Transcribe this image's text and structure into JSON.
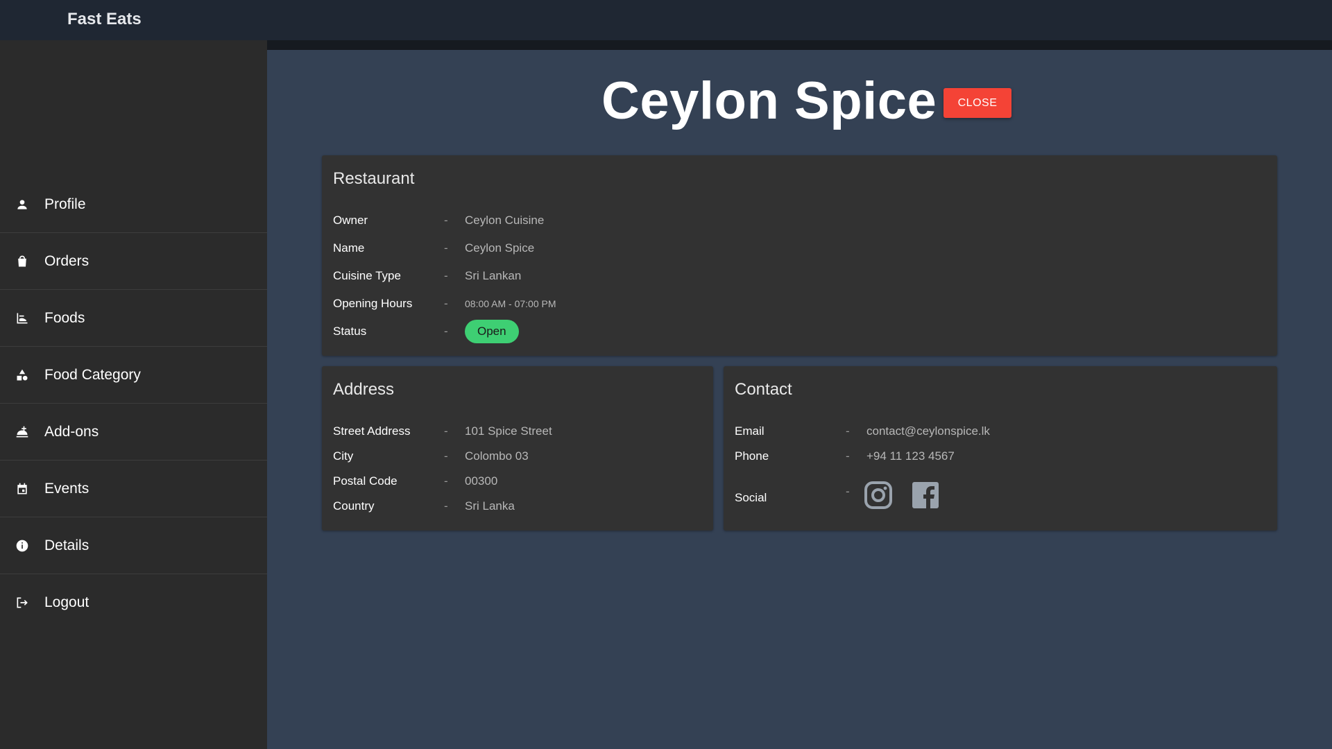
{
  "app": {
    "brand": "Fast Eats"
  },
  "sidebar": {
    "items": [
      {
        "label": "Profile",
        "icon": "person-icon"
      },
      {
        "label": "Orders",
        "icon": "shopping-bag-icon"
      },
      {
        "label": "Foods",
        "icon": "food-icon"
      },
      {
        "label": "Food Category",
        "icon": "category-icon"
      },
      {
        "label": "Add-ons",
        "icon": "addon-icon"
      },
      {
        "label": "Events",
        "icon": "calendar-icon"
      },
      {
        "label": "Details",
        "icon": "info-icon"
      },
      {
        "label": "Logout",
        "icon": "logout-icon"
      }
    ]
  },
  "header": {
    "title": "Ceylon Spice",
    "close_label": "CLOSE"
  },
  "restaurant": {
    "title": "Restaurant",
    "rows": [
      {
        "label": "Owner",
        "value": "Ceylon Cuisine"
      },
      {
        "label": "Name",
        "value": "Ceylon Spice"
      },
      {
        "label": "Cuisine Type",
        "value": "Sri Lankan"
      },
      {
        "label": "Opening Hours",
        "value": "08:00 AM - 07:00 PM"
      },
      {
        "label": "Status",
        "value": "Open"
      }
    ]
  },
  "address": {
    "title": "Address",
    "rows": [
      {
        "label": "Street Address",
        "value": "101 Spice Street"
      },
      {
        "label": "City",
        "value": "Colombo 03"
      },
      {
        "label": "Postal Code",
        "value": "00300"
      },
      {
        "label": "Country",
        "value": "Sri Lanka"
      }
    ]
  },
  "contact": {
    "title": "Contact",
    "rows": [
      {
        "label": "Email",
        "value": "contact@ceylonspice.lk"
      },
      {
        "label": "Phone",
        "value": "+94 11 123 4567"
      },
      {
        "label": "Social",
        "value": ""
      }
    ],
    "social": [
      "instagram-icon",
      "facebook-icon"
    ]
  },
  "separator": "-",
  "colors": {
    "close_button": "#f44336",
    "status_open": "#3ecf73",
    "main_bg": "#344154",
    "sidebar_bg": "#2b2b2b",
    "card_bg": "#323232"
  }
}
